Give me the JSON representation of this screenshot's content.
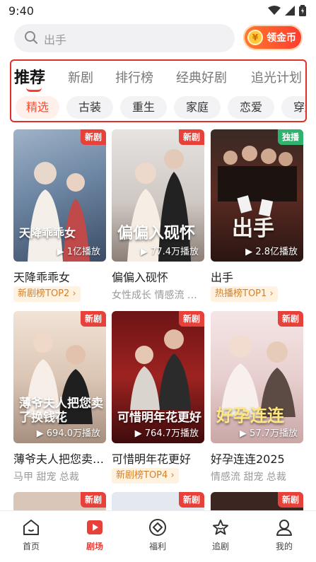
{
  "status_bar": {
    "time": "9:40"
  },
  "search": {
    "placeholder": "出手",
    "coin_button": "领金币",
    "coin_symbol": "¥"
  },
  "tabs": [
    {
      "label": "推荐",
      "active": true
    },
    {
      "label": "新剧"
    },
    {
      "label": "排行榜"
    },
    {
      "label": "经典好剧"
    },
    {
      "label": "追光计划"
    }
  ],
  "chips": [
    {
      "label": "精选",
      "active": true
    },
    {
      "label": "古装"
    },
    {
      "label": "重生"
    },
    {
      "label": "家庭"
    },
    {
      "label": "恋爱"
    },
    {
      "label": "穿越"
    }
  ],
  "dramas": [
    {
      "title": "天降乖乖女",
      "badge": "新剧",
      "plays": "1亿播放",
      "poster_text": "天降乖乖女",
      "tag": "新剧榜TOP2",
      "subtitle": ""
    },
    {
      "title": "偏偏入砚怀",
      "badge": "新剧",
      "plays": "77.4万播放",
      "poster_text": "偏偏入砚怀",
      "tag": "",
      "subtitle": "女性成长 情感流 …"
    },
    {
      "title": "出手",
      "badge": "独播",
      "plays": "2.8亿播放",
      "poster_text": "出手",
      "tag": "热播榜TOP1",
      "subtitle": ""
    },
    {
      "title": "薄爷夫人把您卖了换钱花",
      "badge": "新剧",
      "plays": "694.0万播放",
      "poster_text": "薄爷夫人把您卖了换钱花",
      "tag": "",
      "subtitle": "马甲 甜宠 总裁"
    },
    {
      "title": "可惜明年花更好",
      "badge": "新剧",
      "plays": "764.7万播放",
      "poster_text": "可惜明年花更好",
      "tag": "新剧榜TOP4",
      "subtitle": ""
    },
    {
      "title": "好孕连连2025",
      "badge": "新剧",
      "plays": "57.7万播放",
      "poster_text": "好孕连连",
      "tag": "",
      "subtitle": "情感流 甜宠 总裁"
    }
  ],
  "peek_badges": [
    "新剧",
    "新剧",
    "新剧"
  ],
  "bottom_nav": [
    {
      "label": "首页",
      "icon": "home-icon"
    },
    {
      "label": "剧场",
      "icon": "theater-play-icon",
      "active": true
    },
    {
      "label": "福利",
      "icon": "welfare-icon"
    },
    {
      "label": "追剧",
      "icon": "follow-star-icon"
    },
    {
      "label": "我的",
      "icon": "profile-icon"
    }
  ],
  "colors": {
    "accent": "#e8413a",
    "badge_new": "#e8413a",
    "badge_exclusive": "#2fb36f",
    "tag_bg": "#fff2e0",
    "tag_text": "#d4822a"
  }
}
